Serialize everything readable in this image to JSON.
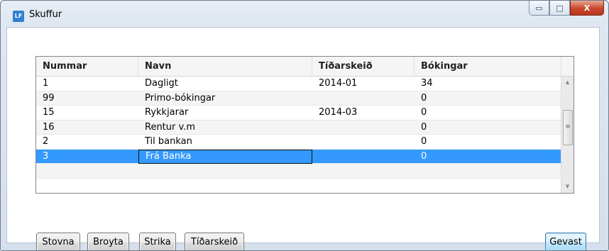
{
  "window": {
    "title": "Skuffur",
    "app_icon_text": "LF"
  },
  "controls": {
    "minimize": "▭",
    "maximize": "□",
    "close": "X"
  },
  "grid": {
    "columns": [
      "Nummar",
      "Navn",
      "Tíðarskeið",
      "Bókingar"
    ],
    "rows": [
      {
        "nummar": "1",
        "navn": "Dagligt",
        "tidarskeid": "2014-01",
        "bokingar": "34"
      },
      {
        "nummar": "99",
        "navn": "Primo-bókingar",
        "tidarskeid": "",
        "bokingar": "0"
      },
      {
        "nummar": "15",
        "navn": "Rykkjarar",
        "tidarskeid": "2014-03",
        "bokingar": "0"
      },
      {
        "nummar": "16",
        "navn": "Rentur v.m",
        "tidarskeid": "",
        "bokingar": "0"
      },
      {
        "nummar": "2",
        "navn": "Til bankan",
        "tidarskeid": "",
        "bokingar": "0"
      },
      {
        "nummar": "3",
        "navn": "Frá Banka",
        "tidarskeid": "",
        "bokingar": "0"
      }
    ],
    "selected_row": 5,
    "scroll": {
      "up": "▲",
      "down": "▼",
      "grip": "≡"
    }
  },
  "buttons": {
    "stovna": "Stovna",
    "broyta": "Broyta",
    "strika": "Strika",
    "tidarskeid": "Tíðarskeið",
    "gevast": "Gevast"
  }
}
